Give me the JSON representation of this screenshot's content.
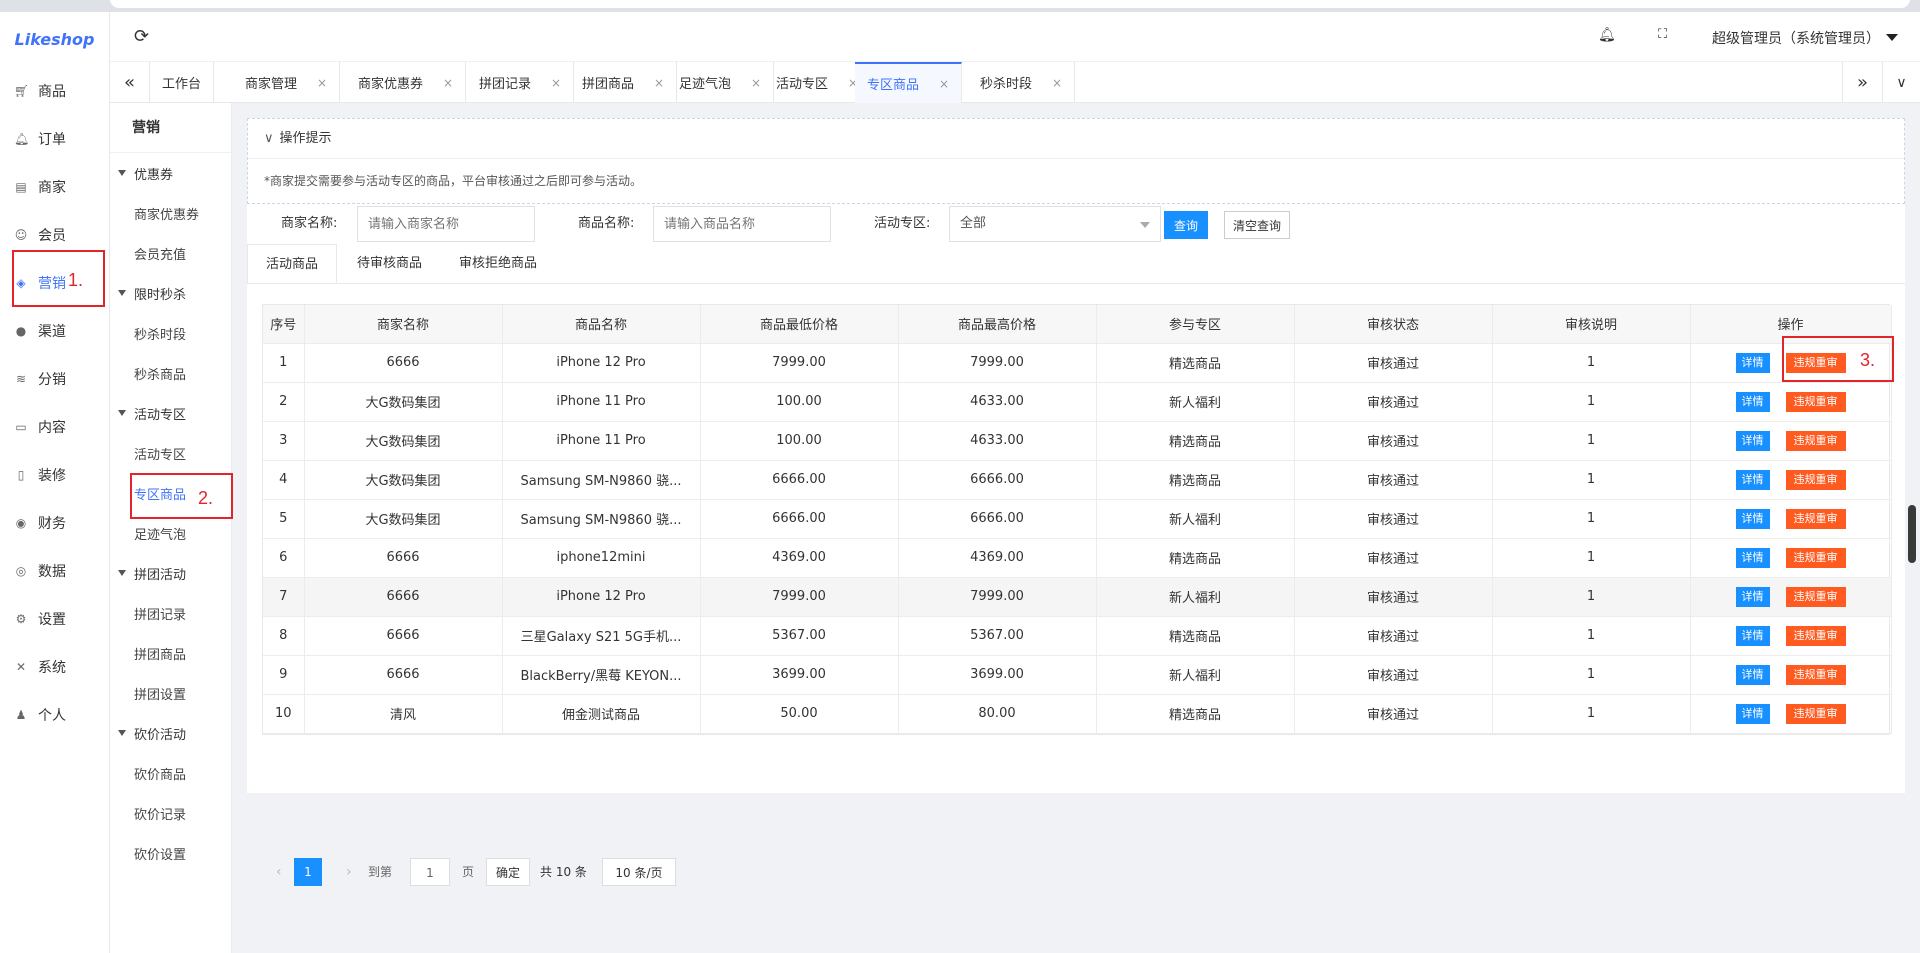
{
  "app": {
    "logo": "Likeshop"
  },
  "header": {
    "user": "超级管理员（系统管理员）"
  },
  "leftnav": [
    {
      "label": "商品",
      "icon": "cart-icon"
    },
    {
      "label": "订单",
      "icon": "bell-icon"
    },
    {
      "label": "商家",
      "icon": "store-icon"
    },
    {
      "label": "会员",
      "icon": "user-icon"
    },
    {
      "label": "营销",
      "icon": "cube-icon",
      "active": true
    },
    {
      "label": "渠道",
      "icon": "channel-icon"
    },
    {
      "label": "分销",
      "icon": "layers-icon"
    },
    {
      "label": "内容",
      "icon": "book-icon"
    },
    {
      "label": "装修",
      "icon": "tablet-icon"
    },
    {
      "label": "财务",
      "icon": "coin-icon"
    },
    {
      "label": "数据",
      "icon": "globe-icon"
    },
    {
      "label": "设置",
      "icon": "gear-icon"
    },
    {
      "label": "系统",
      "icon": "tools-icon"
    },
    {
      "label": "个人",
      "icon": "person-icon"
    }
  ],
  "tabs": [
    {
      "label": "工作台",
      "closable": false
    },
    {
      "label": "商家管理",
      "closable": true
    },
    {
      "label": "商家优惠券",
      "closable": true
    },
    {
      "label": "拼团记录",
      "closable": true
    },
    {
      "label": "拼团商品",
      "closable": true
    },
    {
      "label": "足迹气泡",
      "closable": true
    },
    {
      "label": "活动专区",
      "closable": true
    },
    {
      "label": "专区商品",
      "closable": true,
      "active": true
    },
    {
      "label": "秒杀时段",
      "closable": true
    }
  ],
  "subnav": {
    "title": "营销",
    "groups": [
      {
        "label": "优惠券",
        "items": [
          "商家优惠券",
          "会员充值"
        ]
      },
      {
        "label": "限时秒杀",
        "items": [
          "秒杀时段",
          "秒杀商品"
        ]
      },
      {
        "label": "活动专区",
        "items": [
          "活动专区",
          "专区商品",
          "足迹气泡"
        ]
      },
      {
        "label": "拼团活动",
        "items": [
          "拼团记录",
          "拼团商品",
          "拼团设置"
        ]
      },
      {
        "label": "砍价活动",
        "items": [
          "砍价商品",
          "砍价记录",
          "砍价设置"
        ]
      }
    ]
  },
  "tips": {
    "title": "操作提示",
    "body": "*商家提交需要参与活动专区的商品，平台审核通过之后即可参与活动。"
  },
  "filters": {
    "shop_label": "商家名称:",
    "shop_placeholder": "请输入商家名称",
    "goods_label": "商品名称:",
    "goods_placeholder": "请输入商品名称",
    "area_label": "活动专区:",
    "area_value": "全部",
    "query": "查询",
    "clear": "清空查询"
  },
  "subtabs": [
    "活动商品",
    "待审核商品",
    "审核拒绝商品"
  ],
  "table": {
    "columns": [
      "序号",
      "商家名称",
      "商品名称",
      "商品最低价格",
      "商品最高价格",
      "参与专区",
      "审核状态",
      "审核说明",
      "操作"
    ],
    "detail": "详情",
    "review": "违规重审",
    "rows": [
      [
        "1",
        "6666",
        "iPhone 12 Pro",
        "7999.00",
        "7999.00",
        "精选商品",
        "审核通过",
        "1"
      ],
      [
        "2",
        "大G数码集团",
        "iPhone 11 Pro",
        "100.00",
        "4633.00",
        "新人福利",
        "审核通过",
        "1"
      ],
      [
        "3",
        "大G数码集团",
        "iPhone 11 Pro",
        "100.00",
        "4633.00",
        "精选商品",
        "审核通过",
        "1"
      ],
      [
        "4",
        "大G数码集团",
        "Samsung SM-N9860 骁...",
        "6666.00",
        "6666.00",
        "精选商品",
        "审核通过",
        "1"
      ],
      [
        "5",
        "大G数码集团",
        "Samsung SM-N9860 骁...",
        "6666.00",
        "6666.00",
        "新人福利",
        "审核通过",
        "1"
      ],
      [
        "6",
        "6666",
        "iphone12mini",
        "4369.00",
        "4369.00",
        "精选商品",
        "审核通过",
        "1"
      ],
      [
        "7",
        "6666",
        "iPhone 12 Pro",
        "7999.00",
        "7999.00",
        "新人福利",
        "审核通过",
        "1"
      ],
      [
        "8",
        "6666",
        "三星Galaxy S21 5G手机...",
        "5367.00",
        "5367.00",
        "精选商品",
        "审核通过",
        "1"
      ],
      [
        "9",
        "6666",
        "BlackBerry/黑莓 KEYON...",
        "3699.00",
        "3699.00",
        "新人福利",
        "审核通过",
        "1"
      ],
      [
        "10",
        "清风",
        "佣金测试商品",
        "50.00",
        "80.00",
        "精选商品",
        "审核通过",
        "1"
      ]
    ]
  },
  "pager": {
    "current": "1",
    "goto": "到第",
    "page_input": "1",
    "page": "页",
    "confirm": "确定",
    "total": "共 10 条",
    "size": "10 条/页"
  },
  "annotations": [
    "1.",
    "2.",
    "3."
  ]
}
